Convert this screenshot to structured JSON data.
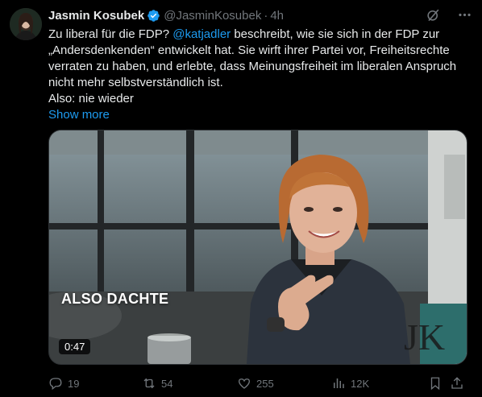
{
  "tweet": {
    "author_name": "Jasmin Kosubek",
    "handle": "@JasminKosubek",
    "separator": "·",
    "time": "4h",
    "text": {
      "part1": "Zu liberal für die FDP? ",
      "mention": "@katjadler",
      "part2": " beschreibt, wie sie sich in der FDP zur „Andersdenkenden“ entwickelt hat. Sie wirft ihrer Partei vor, Freiheitsrechte verraten zu haben, und erlebte, dass Meinungsfreiheit im liberalen Anspruch nicht mehr selbstverständlich ist.",
      "line2": "Also: nie wieder",
      "show_more": "Show more"
    },
    "media": {
      "overlay_caption": "ALSO DACHTE",
      "duration": "0:47",
      "watermark": "JK"
    },
    "stats": {
      "replies": "19",
      "retweets": "54",
      "likes": "255",
      "views": "12K"
    }
  },
  "colors": {
    "background": "#000000",
    "text": "#e7e9ea",
    "muted": "#71767b",
    "link": "#1d9bf0",
    "verified": "#1d9bf0"
  },
  "icons": {
    "verified": "verified-badge-icon",
    "grok": "grok-icon",
    "more": "more-icon",
    "reply": "reply-icon",
    "retweet": "retweet-icon",
    "like": "like-icon",
    "views": "views-icon",
    "bookmark": "bookmark-icon",
    "share": "share-icon"
  }
}
